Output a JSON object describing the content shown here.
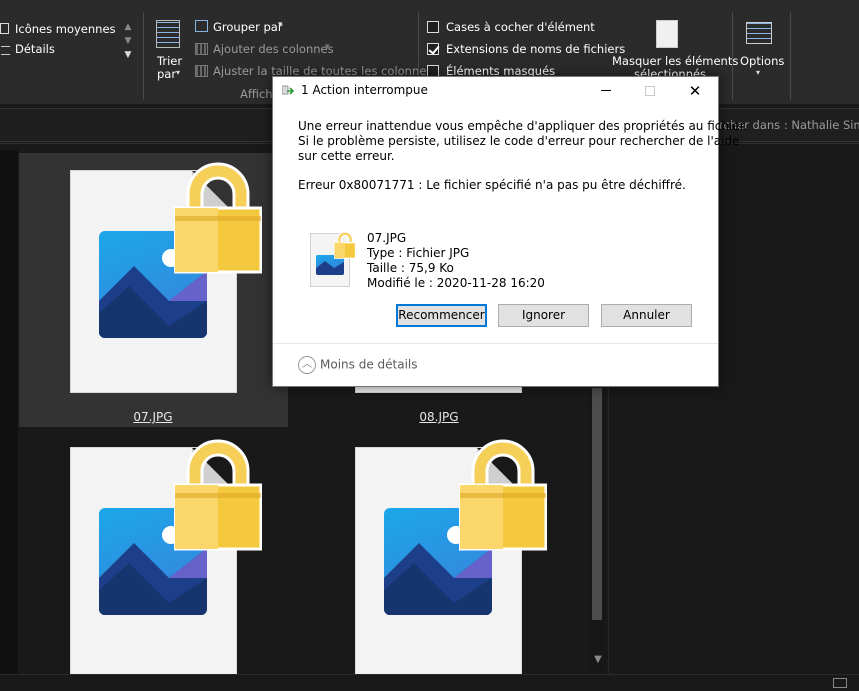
{
  "ribbon": {
    "layout": {
      "medium_icons": "Icônes moyennes",
      "details": "Détails"
    },
    "sort_by": {
      "line1": "Trier",
      "line2": "par"
    },
    "current_view": {
      "group_by": "Grouper par",
      "add_columns": "Ajouter des colonnes",
      "size_all_columns": "Ajuster la taille de toutes les colonnes",
      "group_label": "Afficha"
    },
    "show_hide": {
      "item_checkboxes": "Cases à cocher d'élément",
      "item_checkboxes_checked": false,
      "file_extensions": "Extensions de noms de fichiers",
      "file_extensions_checked": true,
      "hidden_items": "Éléments masqués",
      "hidden_items_checked": false,
      "hide_selected_line1": "Masquer les éléments",
      "hide_selected_line2": "sélectionnés"
    },
    "options": "Options"
  },
  "search": {
    "placeholder": "rcher dans : Nathalie Simar"
  },
  "files": [
    {
      "name": "07.JPG"
    },
    {
      "name": "08.JPG"
    },
    {
      "name": ""
    },
    {
      "name": ""
    }
  ],
  "dialog": {
    "title": "1 Action interrompue",
    "message_line1": "Une erreur inattendue vous empêche d'appliquer des propriétés au fichier.",
    "message_line2": "Si le problème persiste, utilisez le code d'erreur pour rechercher de l'aide",
    "message_line3": "sur cette erreur.",
    "error_line": "Erreur 0x80071771 : Le fichier spécifié n'a pas pu être déchiffré.",
    "file": {
      "name": "07.JPG",
      "type": "Type : Fichier JPG",
      "size": "Taille : 75,9 Ko",
      "modified": "Modifié le : 2020-11-28 16:20"
    },
    "buttons": {
      "retry": "Recommencer",
      "ignore": "Ignorer",
      "cancel": "Annuler"
    },
    "less_details": "Moins de détails"
  }
}
